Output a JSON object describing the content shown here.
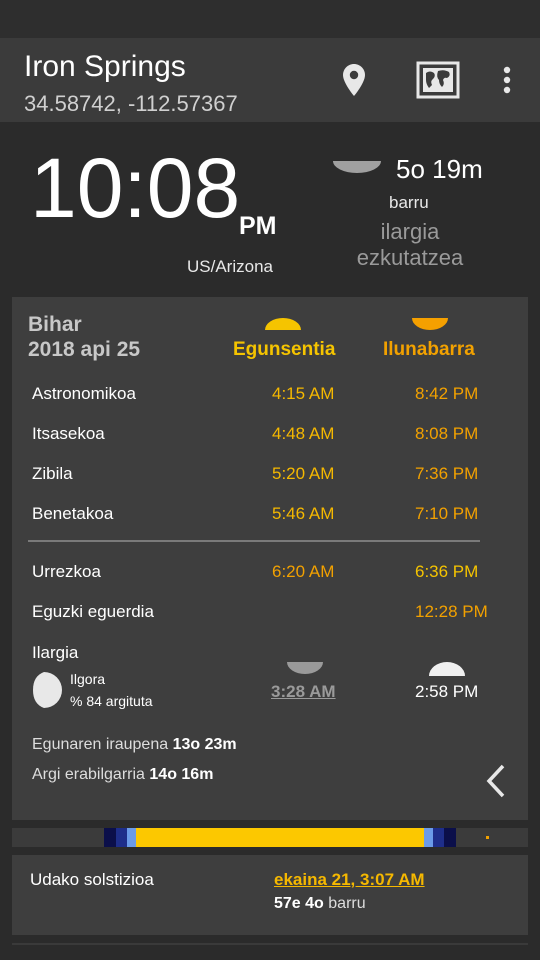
{
  "header": {
    "title": "Iron Springs",
    "coordinates": "34.58742, -112.57367",
    "icons": [
      "location-pin-icon",
      "map-icon",
      "more-vert-icon"
    ]
  },
  "now": {
    "time": "10:08",
    "ampm": "PM",
    "timezone": "US/Arizona",
    "next_event_in": "5o 19m",
    "next_event_suffix": "barru",
    "next_event_name_line1": "ilargia",
    "next_event_name_line2": "ezkutatzea"
  },
  "card": {
    "day_label": "Bihar",
    "date": "2018 api 25",
    "col_sunrise": "Egunsentia",
    "col_sunset": "Ilunabarra",
    "twilight_rows": [
      {
        "label": "Astronomikoa",
        "rise": "4:15 AM",
        "set": "8:42 PM"
      },
      {
        "label": "Itsasekoa",
        "rise": "4:48 AM",
        "set": "8:08 PM"
      },
      {
        "label": "Zibila",
        "rise": "5:20 AM",
        "set": "7:36 PM"
      },
      {
        "label": "Benetakoa",
        "rise": "5:46 AM",
        "set": "7:10 PM"
      }
    ],
    "golden": {
      "label": "Urrezkoa",
      "rise": "6:20 AM",
      "set": "6:36 PM"
    },
    "noon": {
      "label": "Eguzki eguerdia",
      "time": "12:28 PM"
    },
    "moon": {
      "label": "Ilargia",
      "phase": "Ilgora",
      "illumination": "% 84 argituta",
      "rise": "3:28 AM",
      "set": "2:58 PM"
    },
    "day_length_label": "Egunaren iraupena",
    "day_length": "13o 23m",
    "usable_light_label": "Argi erabilgarria",
    "usable_light": "14o 16m"
  },
  "solstice": {
    "label": "Udako solstizioa",
    "date": "ekaina 21, 3:07 AM",
    "in_value": "57e 4o",
    "in_suffix": "barru"
  },
  "colors": {
    "sunrise": "#f5b800",
    "sunset": "#f2a100",
    "background": "#2b2b2b",
    "card": "#3e3e3e"
  }
}
